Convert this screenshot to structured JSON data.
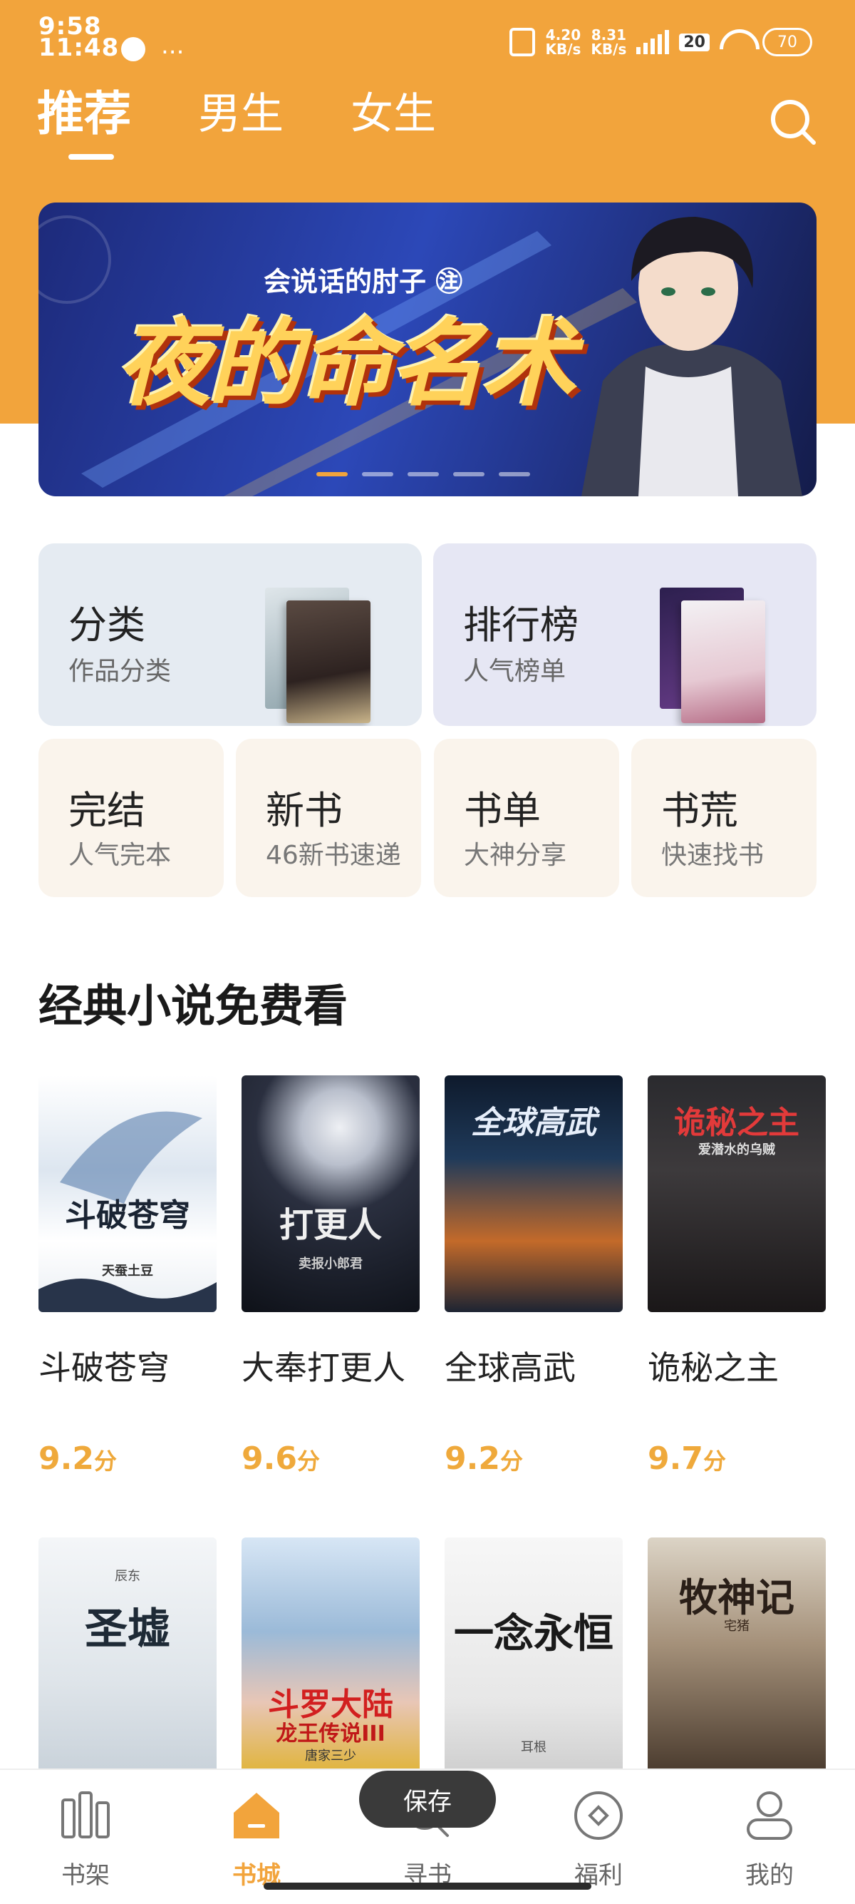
{
  "status": {
    "time_top": "9:58",
    "time_bottom": "11:48",
    "more": "...",
    "net_speed_1": "4.20",
    "net_speed_1_unit": "KB/s",
    "net_speed_2": "8.31",
    "net_speed_2_unit": "KB/s",
    "badge": "20",
    "battery": "70"
  },
  "top_tabs": [
    {
      "label": "推荐",
      "active": true
    },
    {
      "label": "男生",
      "active": false
    },
    {
      "label": "女生",
      "active": false
    }
  ],
  "banner": {
    "author": "会说话的肘子 ㊟",
    "title": "夜的命名术",
    "page_count": 5,
    "active_page": 1
  },
  "entries_large": [
    {
      "title": "分类",
      "subtitle": "作品分类"
    },
    {
      "title": "排行榜",
      "subtitle": "人气榜单"
    }
  ],
  "entries_small": [
    {
      "title": "完结",
      "subtitle": "人气完本"
    },
    {
      "title": "新书",
      "subtitle": "46新书速递"
    },
    {
      "title": "书单",
      "subtitle": "大神分享"
    },
    {
      "title": "书荒",
      "subtitle": "快速找书"
    }
  ],
  "section": {
    "title": "经典小说免费看"
  },
  "books": [
    {
      "name": "斗破苍穹",
      "score": "9.2",
      "unit": "分",
      "cover_text": "斗破苍穹",
      "cover_sub": "天蚕土豆"
    },
    {
      "name": "大奉打更人",
      "score": "9.6",
      "unit": "分",
      "cover_text": "打更人",
      "cover_sub": "卖报小郎君"
    },
    {
      "name": "全球高武",
      "score": "9.2",
      "unit": "分",
      "cover_text": "全球高武",
      "cover_sub": ""
    },
    {
      "name": "诡秘之主",
      "score": "9.7",
      "unit": "分",
      "cover_text": "诡秘之主",
      "cover_sub": "爱潜水的乌贼"
    }
  ],
  "books_row2": [
    {
      "cover_text": "圣墟",
      "cover_sub": "辰东"
    },
    {
      "cover_text": "斗罗大陆",
      "cover_sub": "龙王传说III",
      "cover_author": "唐家三少"
    },
    {
      "cover_text": "一念永恒",
      "cover_sub": "耳根"
    },
    {
      "cover_text": "牧神记",
      "cover_sub": "宅猪"
    }
  ],
  "toast": "保存",
  "bottom_nav": [
    {
      "label": "书架",
      "icon": "bookshelf-icon",
      "active": false
    },
    {
      "label": "书城",
      "icon": "bookstore-icon",
      "active": true
    },
    {
      "label": "寻书",
      "icon": "find-book-icon",
      "active": false
    },
    {
      "label": "福利",
      "icon": "welfare-icon",
      "active": false
    },
    {
      "label": "我的",
      "icon": "profile-icon",
      "active": false
    }
  ],
  "colors": {
    "accent": "#f2a43c",
    "score": "#efa93b"
  }
}
